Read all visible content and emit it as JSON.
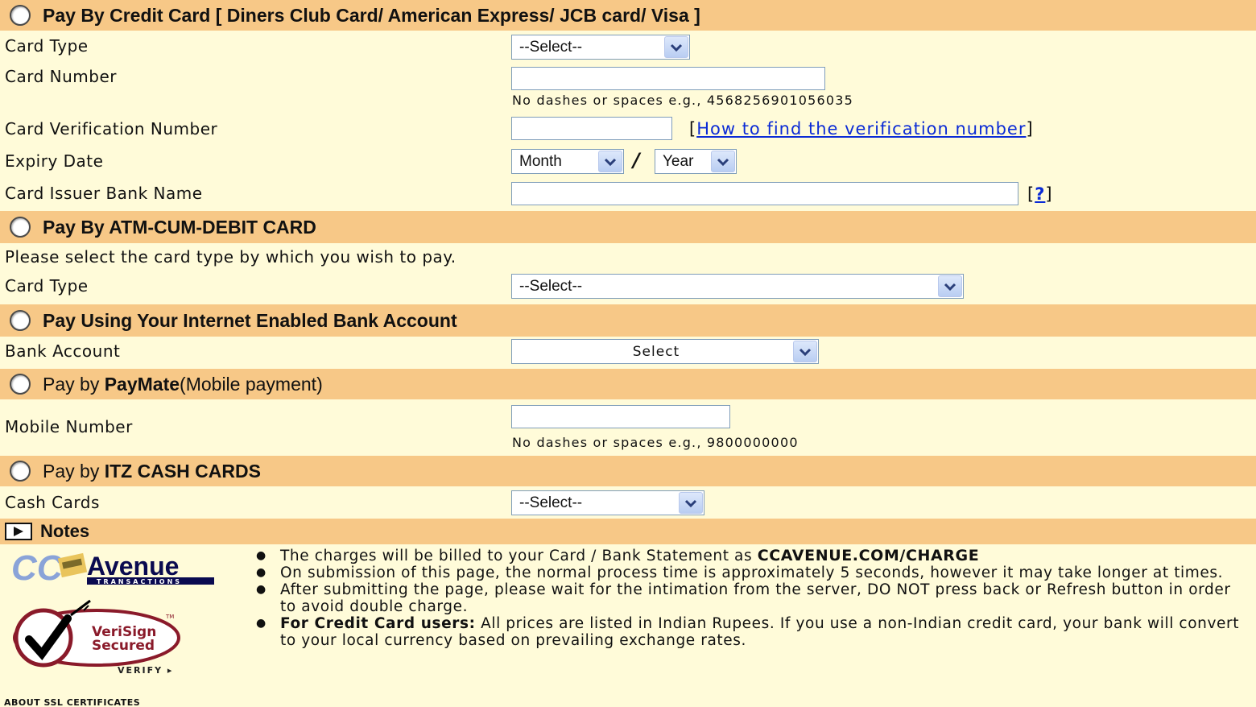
{
  "credit": {
    "title": "Pay By Credit Card [ Diners Club Card/ American Express/ JCB card/ Visa ]",
    "card_type_label": "Card Type",
    "card_type_value": "--Select--",
    "card_number_label": "Card Number",
    "card_number_hint": "No dashes or spaces e.g., 4568256901056035",
    "cvv_label": "Card Verification Number",
    "cvv_link": "How to find the verification number",
    "expiry_label": "Expiry Date",
    "month_value": "Month",
    "slash": "/",
    "year_value": "Year",
    "issuer_label": "Card Issuer Bank Name",
    "issuer_help": "?"
  },
  "atm": {
    "title": "Pay By ATM-CUM-DEBIT CARD",
    "instruction": "Please select the card type by which you wish to pay.",
    "card_type_label": "Card Type",
    "card_type_value": "--Select--"
  },
  "netbank": {
    "title": "Pay Using Your Internet Enabled Bank Account",
    "bank_label": "Bank Account",
    "bank_value": "Select"
  },
  "paymate": {
    "title_prefix": "Pay by ",
    "title_brand": "PayMate",
    "title_suffix": "(Mobile payment)",
    "mobile_label": "Mobile Number",
    "mobile_hint": "No dashes or spaces e.g., 9800000000"
  },
  "itz": {
    "title_prefix": "Pay by ",
    "title_brand": "ITZ CASH CARDS",
    "cash_label": "Cash Cards",
    "cash_value": "--Select--"
  },
  "notes": {
    "title": "Notes",
    "item1_text": "The charges will be billed to your Card / Bank Statement as ",
    "item1_bold": "CCAVENUE.COM/CHARGE",
    "item2": "On submission of this page, the normal process time is approximately 5 seconds, however it may take longer at times.",
    "item3": "After submitting the page, please wait for the intimation from the server, DO NOT press back or Refresh button in order to avoid double charge.",
    "item4_bold": "For Credit Card users:",
    "item4_text": " All prices are listed in Indian Rupees. If you use a non-Indian credit card, your bank will convert to your local currency based on prevailing exchange rates."
  },
  "logos": {
    "ccavenue": "Avenue",
    "ccavenue_sub": "TRANSACTIONS",
    "verisign_line1": "VeriSign",
    "verisign_line2": "Secured",
    "verisign_tm": "TM",
    "verisign_verify": "VERIFY ▸",
    "ssl": "ABOUT SSL CERTIFICATES"
  },
  "colors": {
    "header_bg": "#f7c887",
    "row_bg": "#fffbd9",
    "link": "#0b2bd6"
  }
}
